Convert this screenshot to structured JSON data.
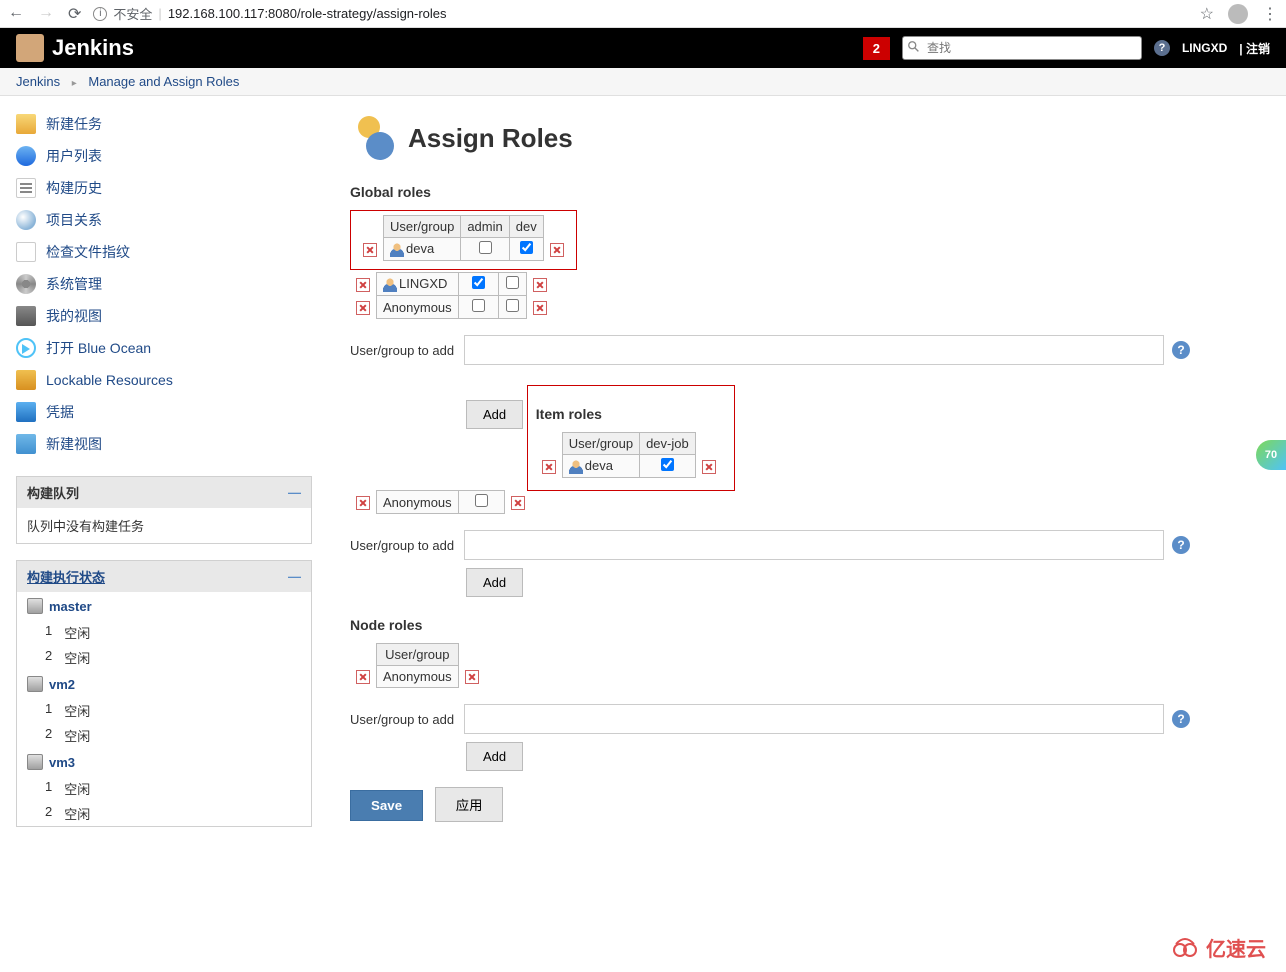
{
  "browser": {
    "insecure_label": "不安全",
    "url": "192.168.100.117:8080/role-strategy/assign-roles"
  },
  "header": {
    "brand": "Jenkins",
    "notif_count": "2",
    "search_placeholder": "查找",
    "username": "LINGXD",
    "logout": "| 注销"
  },
  "breadcrumb": {
    "items": [
      "Jenkins",
      "Manage and Assign Roles"
    ]
  },
  "sidebar": {
    "nav": [
      {
        "label": "新建任务",
        "icon": "ic-new"
      },
      {
        "label": "用户列表",
        "icon": "ic-users"
      },
      {
        "label": "构建历史",
        "icon": "ic-history"
      },
      {
        "label": "项目关系",
        "icon": "ic-search"
      },
      {
        "label": "检查文件指纹",
        "icon": "ic-fingerprint"
      },
      {
        "label": "系统管理",
        "icon": "ic-gear"
      },
      {
        "label": "我的视图",
        "icon": "ic-view"
      },
      {
        "label": "打开 Blue Ocean",
        "icon": "ic-ocean"
      },
      {
        "label": "Lockable Resources",
        "icon": "ic-lock"
      },
      {
        "label": "凭据",
        "icon": "ic-cred"
      },
      {
        "label": "新建视图",
        "icon": "ic-folder"
      }
    ],
    "queue": {
      "title": "构建队列",
      "empty": "队列中没有构建任务"
    },
    "executors": {
      "title": "构建执行状态",
      "nodes": [
        {
          "name": "master",
          "slots": [
            {
              "n": "1",
              "s": "空闲"
            },
            {
              "n": "2",
              "s": "空闲"
            }
          ]
        },
        {
          "name": "vm2",
          "slots": [
            {
              "n": "1",
              "s": "空闲"
            },
            {
              "n": "2",
              "s": "空闲"
            }
          ]
        },
        {
          "name": "vm3",
          "slots": [
            {
              "n": "1",
              "s": "空闲"
            },
            {
              "n": "2",
              "s": "空闲"
            }
          ]
        }
      ]
    }
  },
  "main": {
    "title": "Assign Roles",
    "global": {
      "title": "Global roles",
      "header": [
        "User/group",
        "admin",
        "dev"
      ],
      "rows": [
        {
          "name": "deva",
          "admin": false,
          "dev": true,
          "hl": true
        },
        {
          "name": "LINGXD",
          "admin": true,
          "dev": false,
          "hl": false
        },
        {
          "name": "Anonymous",
          "admin": false,
          "dev": false,
          "hl": false
        }
      ]
    },
    "item": {
      "title": "Item roles",
      "header": [
        "User/group",
        "dev-job"
      ],
      "rows": [
        {
          "name": "deva",
          "devjob": true
        },
        {
          "name": "Anonymous",
          "devjob": false
        }
      ]
    },
    "node": {
      "title": "Node roles",
      "header": [
        "User/group"
      ],
      "rows": [
        {
          "name": "Anonymous"
        }
      ]
    },
    "add_label": "User/group to add",
    "add_btn": "Add",
    "save": "Save",
    "apply": "应用"
  },
  "floating": "70",
  "watermark": "亿速云"
}
